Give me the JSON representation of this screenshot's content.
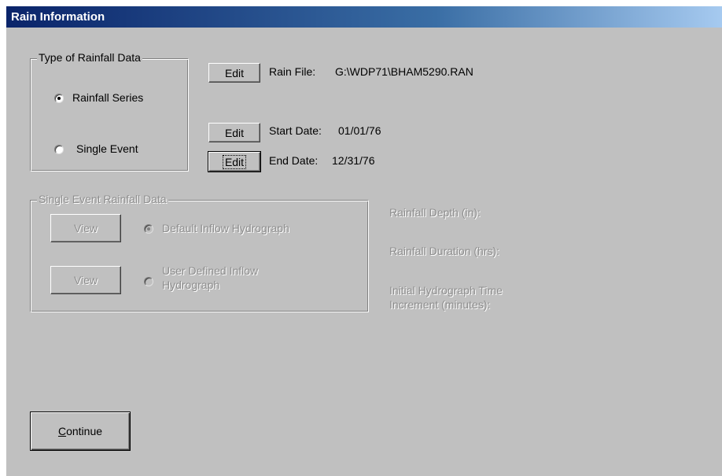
{
  "window": {
    "title": "Rain Information"
  },
  "rainfall_type": {
    "legend": "Type of Rainfall Data",
    "options": [
      {
        "label": "Rainfall Series",
        "checked": true
      },
      {
        "label": "Single Event",
        "checked": false
      }
    ]
  },
  "edit_buttons": {
    "label": "Edit"
  },
  "rain_file": {
    "label": "Rain File:",
    "value": "G:\\WDP71\\BHAM5290.RAN"
  },
  "start_date": {
    "label": "Start Date:",
    "value": "01/01/76"
  },
  "end_date": {
    "label": "End Date:",
    "value": "12/31/76"
  },
  "single_event": {
    "legend": "Single Event Rainfall Data",
    "view_label": "View",
    "default_inflow": "Default Inflow Hydrograph",
    "user_inflow_line1": "User Defined Inflow",
    "user_inflow_line2": "Hydrograph"
  },
  "rainfall_params": {
    "depth": "Rainfall Depth (in):",
    "duration": "Rainfall Duration (hrs):",
    "increment_line1": "Initial Hydrograph Time",
    "increment_line2": "Increment (minutes):"
  },
  "footer": {
    "continue_rest": "ontinue",
    "continue_accel": "C"
  }
}
